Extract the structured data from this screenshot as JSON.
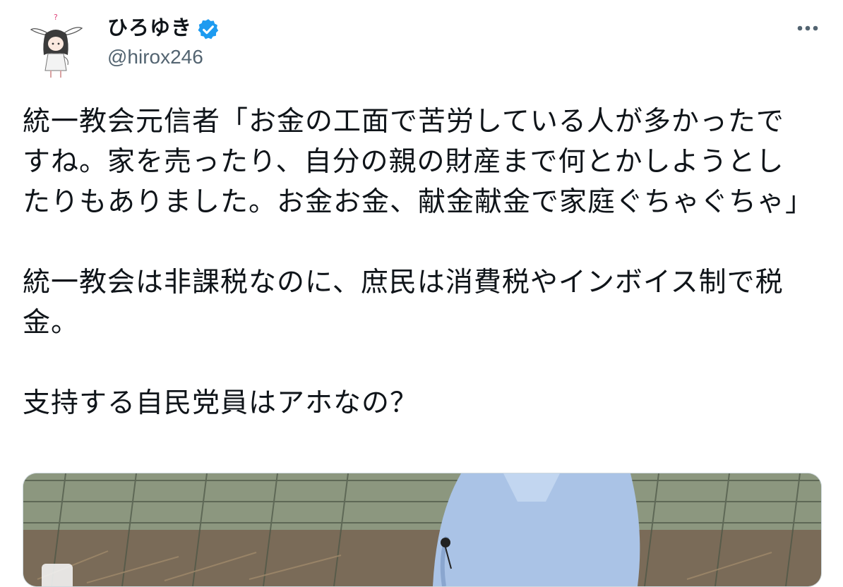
{
  "author": {
    "display_name": "ひろゆき",
    "handle": "@hirox246",
    "verified": true,
    "avatar_icon": "rabbit-ear-girl-avatar",
    "verified_icon": "verified-badge-icon",
    "verified_color": "#1d9bf0"
  },
  "header": {
    "more_icon": "more-horizontal-icon"
  },
  "tweet": {
    "paragraphs": [
      "統一教会元信者「お金の工面で苦労している人が多かったですね。家を売ったり、自分の親の財産まで何とかしようとしたりもありました。お金お金、献金献金で家庭ぐちゃぐちゃ」",
      "統一教会は非課税なのに、庶民は消費税やインボイス制で税金。",
      "支持する自民党員はアホなの？"
    ]
  },
  "media": {
    "type": "video-thumbnail",
    "description_icon": "photo-of-man-in-blue-shirt-by-fence"
  },
  "colors": {
    "text": "#0f1419",
    "secondary_text": "#536471",
    "accent": "#1d9bf0"
  }
}
